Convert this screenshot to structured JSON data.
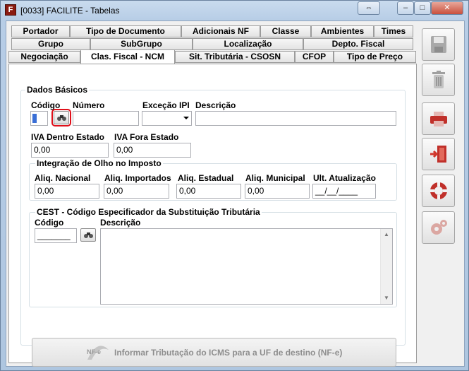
{
  "window": {
    "title": "[0033] FACILITE - Tabelas",
    "app_icon_letter": "F",
    "restore_symbol": "⇔",
    "minimize_symbol": "–",
    "maximize_symbol": "□",
    "close_symbol": "✕"
  },
  "tabs": {
    "row1": [
      "Portador",
      "Tipo de Documento",
      "Adicionais NF",
      "Classe",
      "Ambientes",
      "Times"
    ],
    "row2": [
      "Grupo",
      "SubGrupo",
      "Localização",
      "Depto. Fiscal"
    ],
    "row3": [
      "Negociação",
      "Clas. Fiscal - NCM",
      "Sit. Tributária - CSOSN",
      "CFOP",
      "Tipo de Preço"
    ],
    "active": "Clas. Fiscal - NCM"
  },
  "dados_basicos": {
    "title": "Dados Básicos",
    "codigo_label": "Código",
    "numero_label": "Número",
    "excecao_ipi_label": "Exceção IPI",
    "descricao_label": "Descrição",
    "codigo_value": "",
    "numero_value": "",
    "excecao_ipi_value": "",
    "descricao_value": "",
    "iva_dentro_label": "IVA Dentro Estado",
    "iva_fora_label": "IVA Fora Estado",
    "iva_dentro_value": "0,00",
    "iva_fora_value": "0,00"
  },
  "olho_imposto": {
    "title": "Integração de Olho no Imposto",
    "aliq_nacional_label": "Aliq. Nacional",
    "aliq_importados_label": "Aliq. Importados",
    "aliq_estadual_label": "Aliq. Estadual",
    "aliq_municipal_label": "Aliq. Municipal",
    "ult_atualizacao_label": "Ult. Atualização",
    "aliq_nacional_value": "0,00",
    "aliq_importados_value": "0,00",
    "aliq_estadual_value": "0,00",
    "aliq_municipal_value": "0,00",
    "ult_atualizacao_value": "__/__/____"
  },
  "cest": {
    "title": "CEST - Código Especificador da Substituição Tributária",
    "codigo_label": "Código",
    "descricao_label": "Descrição",
    "codigo_value": "_______",
    "descricao_value": ""
  },
  "nfe_button": {
    "label": "Informar Tributação do ICMS para a UF de destino (NF-e)",
    "logo_text": "NF-e"
  },
  "toolbar": {
    "icons": [
      "save-disk-icon",
      "trash-icon",
      "print-icon",
      "exit-door-icon",
      "help-lifebuoy-icon",
      "settings-gears-icon"
    ]
  },
  "colors": {
    "highlight": "#e0101a",
    "disabled_text": "#8d8d8d",
    "toolbar_red": "#c0302a"
  }
}
